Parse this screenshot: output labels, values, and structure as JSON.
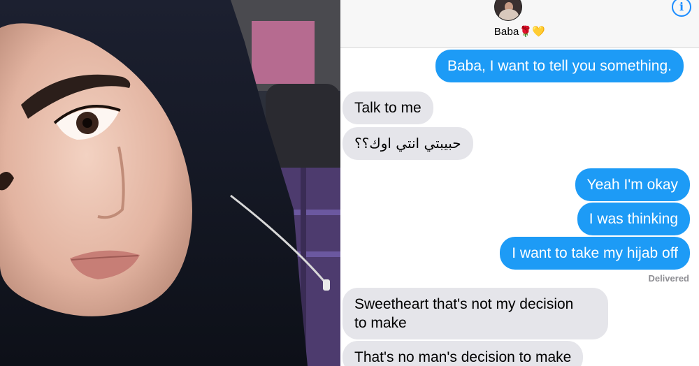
{
  "thread": {
    "contact": {
      "name": "Baba🌹💛",
      "info_icon": "info-icon"
    },
    "messages": [
      {
        "sender": "me",
        "text": "Baba, I want to tell you something."
      },
      {
        "sender": "them",
        "text": "Talk to me"
      },
      {
        "sender": "them",
        "text": "حبيبتي انتي اوك؟؟"
      },
      {
        "sender": "me",
        "text": "Yeah I'm okay"
      },
      {
        "sender": "me",
        "text": "I was thinking"
      },
      {
        "sender": "me",
        "text": "I want to take my hijab off"
      },
      {
        "sender": "them",
        "text_line1": "Sweetheart that's not my decision",
        "text_line2": "to make"
      },
      {
        "sender": "them",
        "text": "That's no man's decision to make"
      }
    ],
    "status": "Delivered"
  },
  "colors": {
    "outgoing_bubble": "#1d9bf6",
    "incoming_bubble": "#e5e5ea",
    "info_icon": "#1a8cff"
  }
}
